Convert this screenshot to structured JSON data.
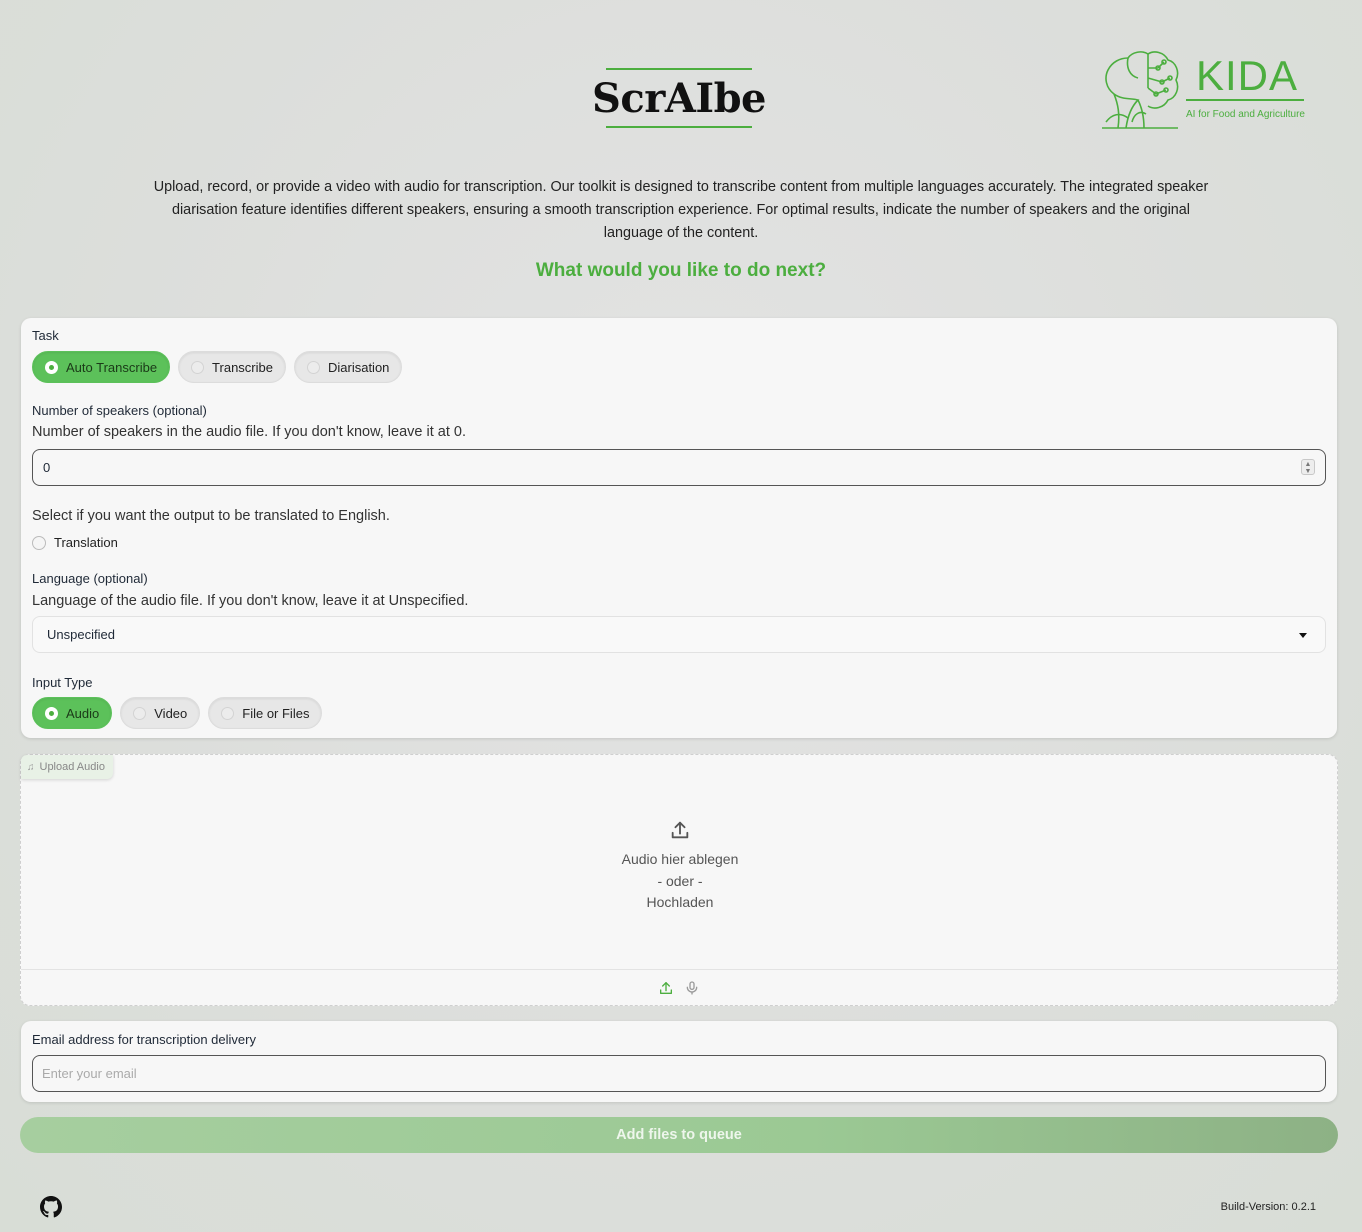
{
  "header": {
    "title": "ScrAIbe",
    "logo_word": "KIDA",
    "logo_subtitle": "AI for Food and Agriculture",
    "accent_color": "#4cae3f"
  },
  "intro": {
    "description": "Upload, record, or provide a video with audio for transcription. Our toolkit is designed to transcribe content from multiple languages accurately. The integrated speaker diarisation feature identifies different speakers, ensuring a smooth transcription experience. For optimal results, indicate the number of speakers and the original language of the content.",
    "prompt": "What would you like to do next?"
  },
  "task": {
    "label": "Task",
    "options": [
      "Auto Transcribe",
      "Transcribe",
      "Diarisation"
    ],
    "selected": "Auto Transcribe"
  },
  "speakers": {
    "label": "Number of speakers (optional)",
    "info": "Number of speakers in the audio file. If you don't know, leave it at 0.",
    "value": "0"
  },
  "translation": {
    "info": "Select if you want the output to be translated to English.",
    "label": "Translation",
    "checked": false
  },
  "language": {
    "label": "Language (optional)",
    "info": "Language of the audio file. If you don't know, leave it at Unspecified.",
    "value": "Unspecified"
  },
  "input_type": {
    "label": "Input Type",
    "options": [
      "Audio",
      "Video",
      "File or Files"
    ],
    "selected": "Audio"
  },
  "upload": {
    "tag": "Upload Audio",
    "drop_text": "Audio hier ablegen",
    "or_text": "- oder -",
    "upload_text": "Hochladen",
    "icons": [
      "upload-icon",
      "microphone-icon"
    ]
  },
  "email": {
    "label": "Email address for transcription delivery",
    "placeholder": "Enter your email",
    "value": ""
  },
  "submit": {
    "label": "Add files to queue"
  },
  "footer": {
    "build": "Build-Version: 0.2.1",
    "icon": "github-icon"
  }
}
